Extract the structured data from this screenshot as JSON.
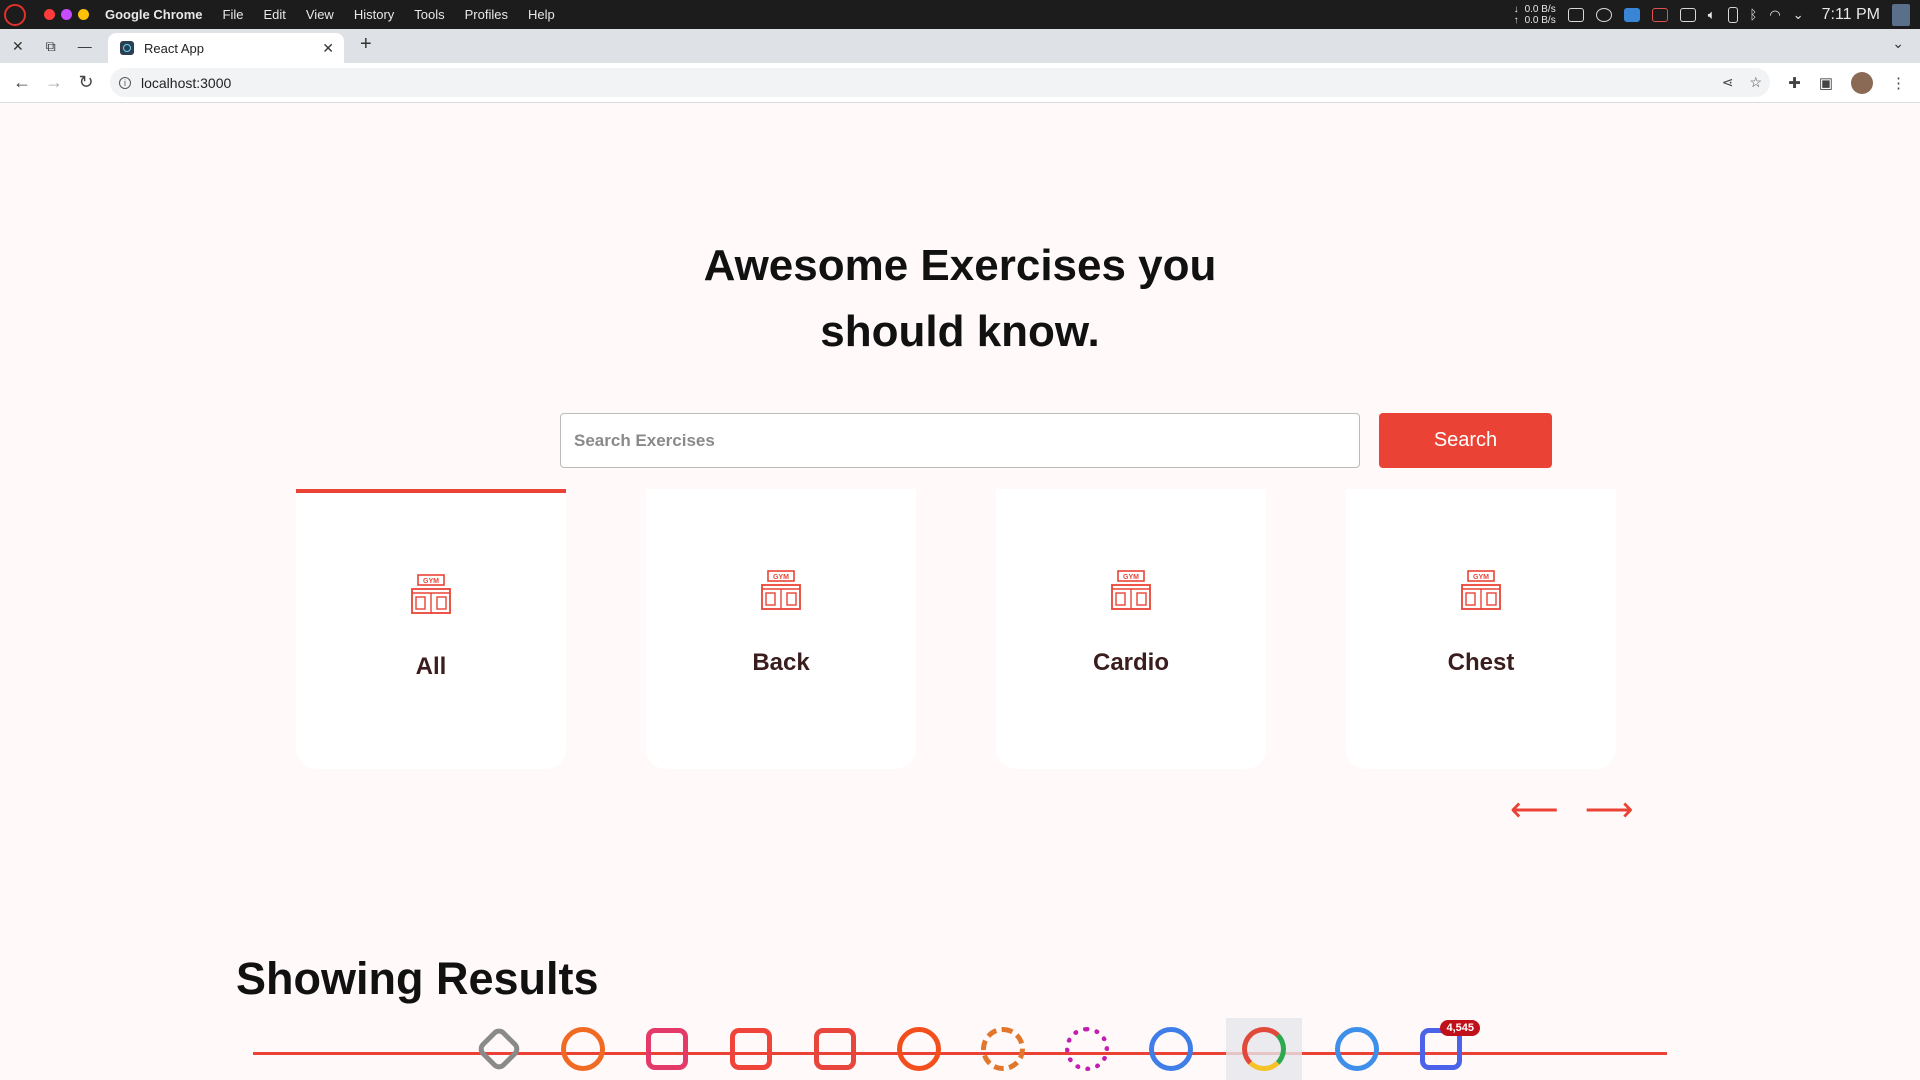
{
  "os": {
    "app_name": "Google Chrome",
    "menu": [
      "File",
      "Edit",
      "View",
      "History",
      "Tools",
      "Profiles",
      "Help"
    ],
    "net_down": "0.0 B/s",
    "net_up": "0.0 B/s",
    "time": "7:11 PM",
    "traffic_colors": [
      "#ff3b3b",
      "#c74bff",
      "#ffc107"
    ]
  },
  "browser": {
    "tab_title": "React App",
    "url": "localhost:3000"
  },
  "page": {
    "hero_line1": "Awesome Exercises you",
    "hero_line2": "should know.",
    "search_placeholder": "Search Exercises",
    "search_button": "Search",
    "categories": [
      {
        "label": "All",
        "active": true
      },
      {
        "label": "Back",
        "active": false
      },
      {
        "label": "Cardio",
        "active": false
      },
      {
        "label": "Chest",
        "active": false
      }
    ],
    "results_title": "Showing Results",
    "accent_color": "#ea4335"
  },
  "dock": {
    "badge": "4,545",
    "apps": [
      "app-store-icon",
      "firefox-icon",
      "terminal-icon",
      "files-icon",
      "system-monitor-icon",
      "disk-usage-icon",
      "settings-gear-icon",
      "flower-settings-icon",
      "vscode-icon",
      "chrome-icon",
      "media-player-icon",
      "wps-icon"
    ]
  }
}
